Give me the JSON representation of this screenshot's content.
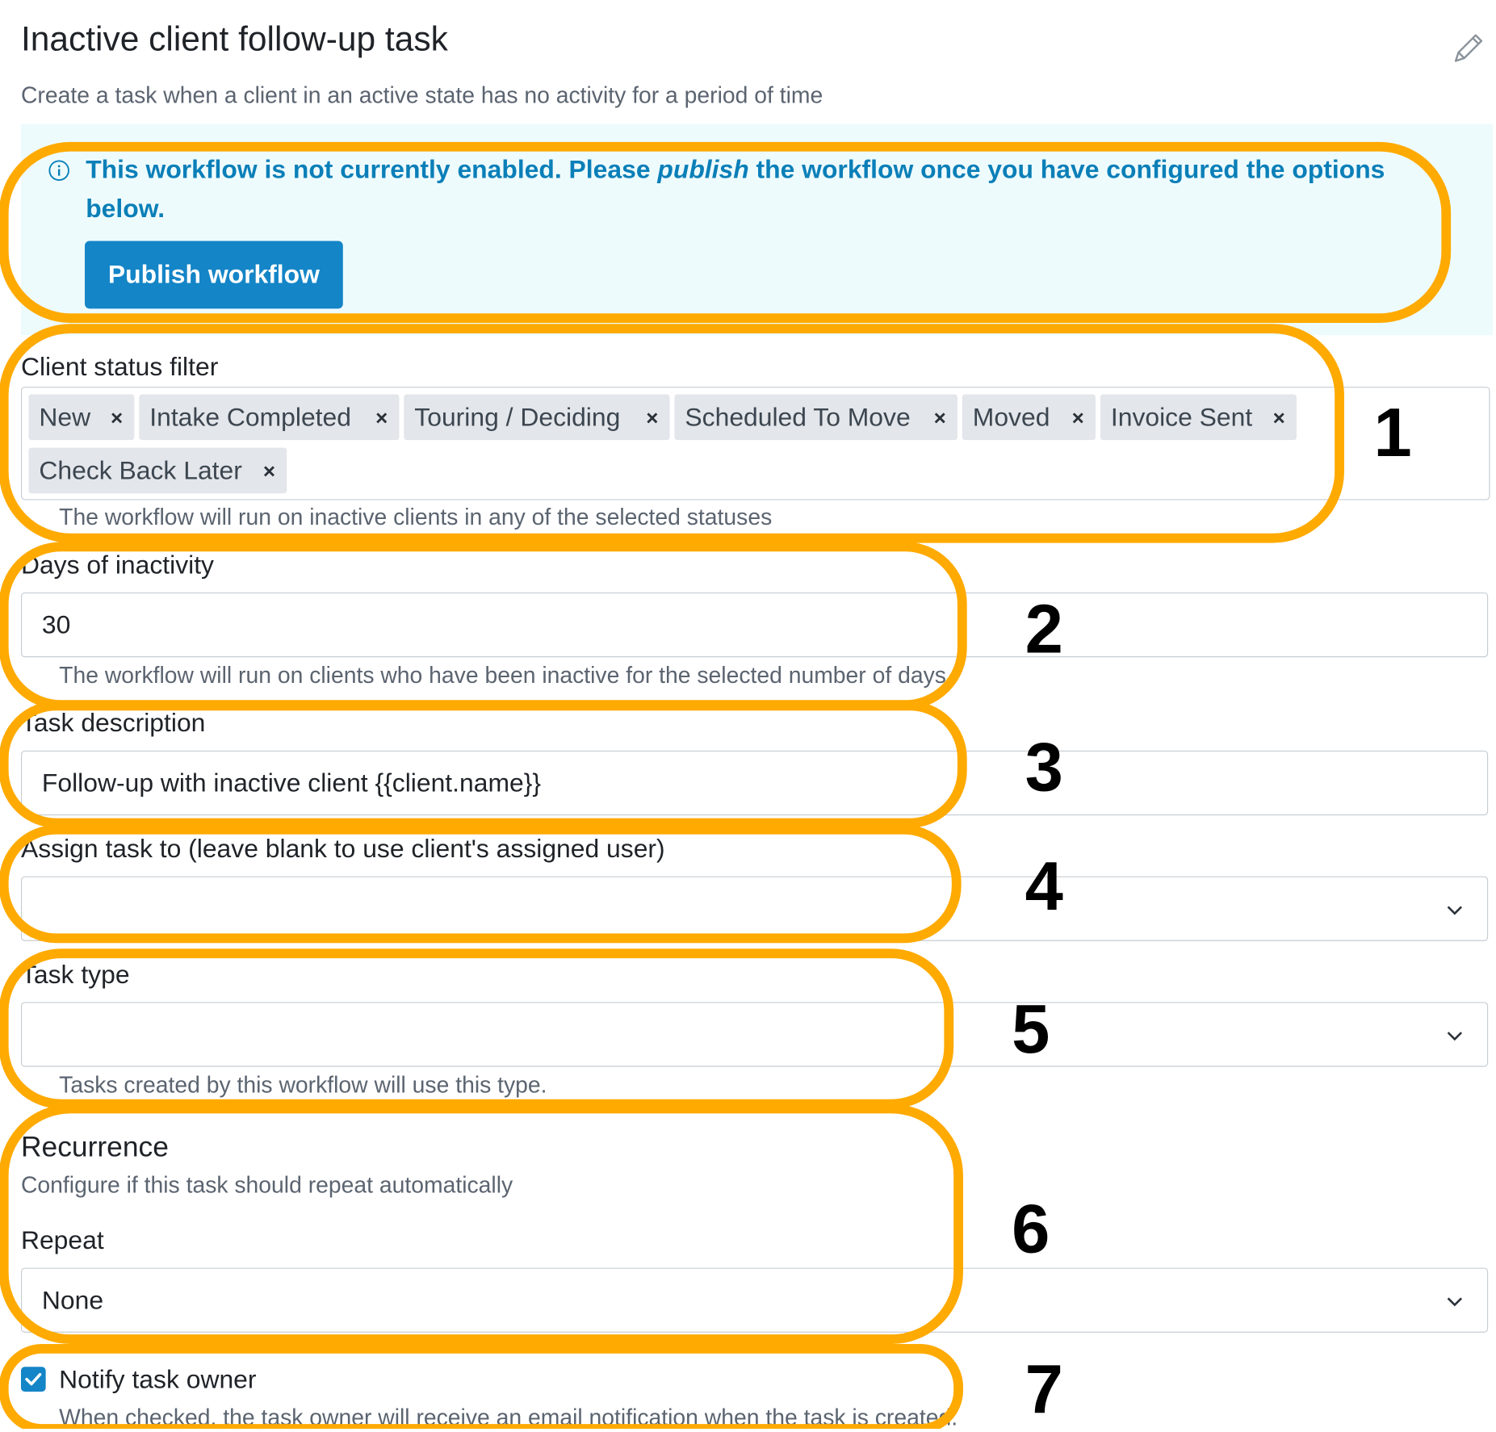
{
  "header": {
    "title": "Inactive client follow-up task",
    "subtitle": "Create a task when a client in an active state has no activity for a period of time",
    "edit_icon": "pencil-icon"
  },
  "alert": {
    "icon": "info-icon",
    "text_before": "This workflow is not currently enabled. Please ",
    "text_emphasis": "publish",
    "text_after": " the workflow once you have configured the options below.",
    "button_label": "Publish workflow",
    "colors": {
      "background": "#eefbfd",
      "text": "#0a7fb8",
      "button": "#1485c7"
    }
  },
  "client_status_filter": {
    "label": "Client status filter",
    "tags": [
      "New",
      "Intake Completed",
      "Touring / Deciding",
      "Scheduled To Move",
      "Moved",
      "Invoice Sent",
      "Check Back Later"
    ],
    "remove_glyph": "×",
    "help": "The workflow will run on inactive clients in any of the selected statuses"
  },
  "days_of_inactivity": {
    "label": "Days of inactivity",
    "value": "30",
    "help": "The workflow will run on clients who have been inactive for the selected number of days."
  },
  "task_description": {
    "label": "Task description",
    "value": "Follow-up with inactive client {{client.name}}"
  },
  "assign_task": {
    "label": "Assign task to (leave blank to use client's assigned user)",
    "value": ""
  },
  "task_type": {
    "label": "Task type",
    "value": "",
    "help": "Tasks created by this workflow will use this type."
  },
  "recurrence": {
    "heading": "Recurrence",
    "subtitle": "Configure if this task should repeat automatically",
    "repeat_label": "Repeat",
    "repeat_value": "None"
  },
  "notify": {
    "checked": true,
    "label": "Notify task owner",
    "help": "When checked, the task owner will receive an email notification when the task is created."
  },
  "annotations": {
    "color": "#ffaa00",
    "number_color": "#e8210e",
    "numbers": [
      "1",
      "2",
      "3",
      "4",
      "5",
      "6",
      "7"
    ]
  }
}
